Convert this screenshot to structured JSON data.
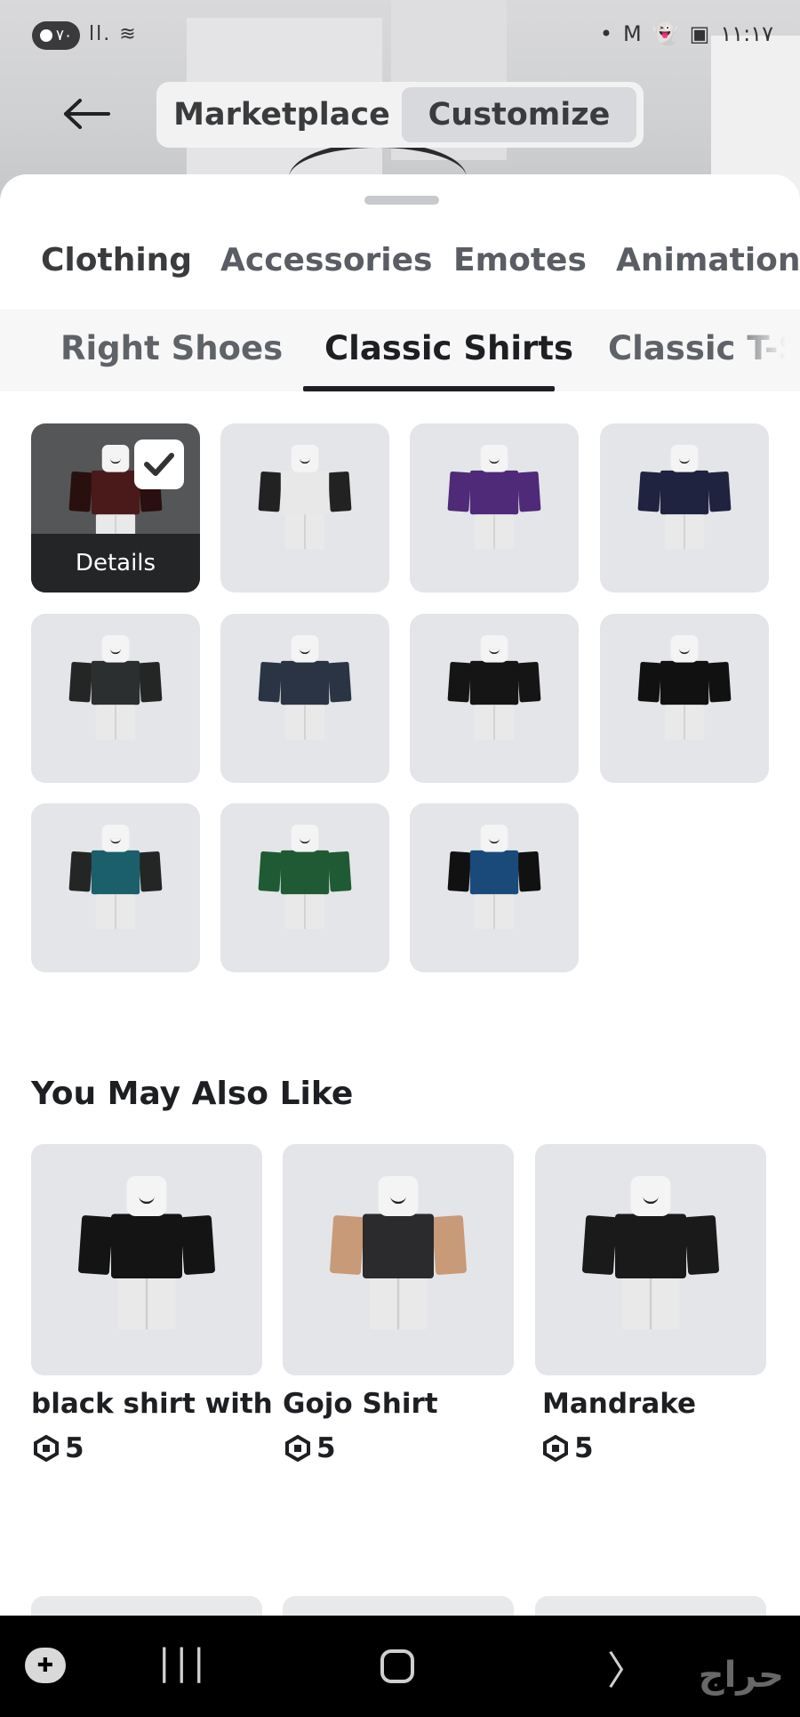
{
  "status_bar": {
    "left_badge": "٧٠",
    "left_icons": "ll. ≋",
    "right_icons": [
      "•",
      "M",
      "👻",
      "▣"
    ],
    "time": "١١:١٧"
  },
  "top_nav": {
    "tabs": [
      "Marketplace",
      "Customize"
    ],
    "selected": "Customize"
  },
  "category_tabs": [
    "Clothing",
    "Accessories",
    "Emotes",
    "Animation"
  ],
  "subcategory_tabs": [
    "Right Shoes",
    "Classic Shirts",
    "Classic T-Sh"
  ],
  "selected_subcategory": "Classic Shirts",
  "grid": {
    "details_label": "Details",
    "items": [
      {
        "shirt": "#4a1a1a",
        "arms": "#2a0f0f"
      },
      {
        "shirt": "#e8e8e8",
        "arms": "#222222"
      },
      {
        "shirt": "#4e2a78",
        "arms": "#4e2a78"
      },
      {
        "shirt": "#1f2340",
        "arms": "#1f2340"
      },
      {
        "shirt": "#2c2f30",
        "arms": "#242626"
      },
      {
        "shirt": "#2b3444",
        "arms": "#2b3444"
      },
      {
        "shirt": "#151515",
        "arms": "#151515"
      },
      {
        "shirt": "#111111",
        "arms": "#111111"
      },
      {
        "shirt": "#1b5f6b",
        "arms": "#242626"
      },
      {
        "shirt": "#1f5a34",
        "arms": "#1f5a34"
      },
      {
        "shirt": "#1a4a7a",
        "arms": "#111111"
      }
    ]
  },
  "recommendations": {
    "title": "You May Also Like",
    "items": [
      {
        "name": "black shirt with",
        "price": "5",
        "shirt": "#141414",
        "arms": "#141414"
      },
      {
        "name": "Gojo Shirt",
        "price": "5",
        "shirt": "#2b2b2e",
        "arms": "#c99a78"
      },
      {
        "name": "Mandrake",
        "price": "5",
        "shirt": "#1a1a1a",
        "arms": "#1a1a1a"
      }
    ]
  },
  "navbar": {
    "recents": "|||",
    "back": "〉",
    "watermark": "حراج"
  }
}
